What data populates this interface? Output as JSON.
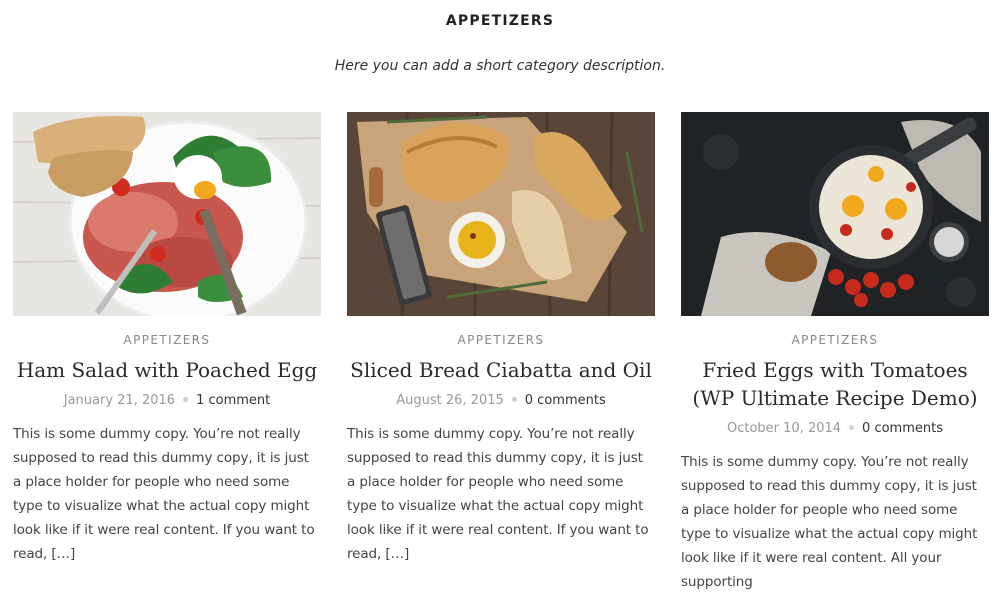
{
  "page": {
    "title": "APPETIZERS",
    "description": "Here you can add a short category description."
  },
  "posts": [
    {
      "category": "APPETIZERS",
      "title": "Ham Salad with Poached Egg",
      "date": "January 21, 2016",
      "comments": "1 comment",
      "excerpt": "This is some dummy copy. You’re not really supposed to read this dummy copy, it is just a place holder for people who need some type to visualize what the actual copy might look like if it were real content. If you want to read, […]"
    },
    {
      "category": "APPETIZERS",
      "title": "Sliced Bread Ciabatta and Oil",
      "date": "August 26, 2015",
      "comments": "0 comments",
      "excerpt": "This is some dummy copy. You’re not really supposed to read this dummy copy, it is just a place holder for people who need some type to visualize what the actual copy might look like if it were real content. If you want to read, […]"
    },
    {
      "category": "APPETIZERS",
      "title": "Fried Eggs with Tomatoes (WP Ultimate Recipe Demo)",
      "date": "October 10, 2014",
      "comments": "0 comments",
      "excerpt": "This is some dummy copy. You’re not really supposed to read this dummy copy, it is just a place holder for people who need some type to visualize what the actual copy might look like if it were real content. All your supporting"
    }
  ],
  "colors": {
    "text": "#333333",
    "muted": "#888888",
    "dot": "#cfcfcf"
  }
}
